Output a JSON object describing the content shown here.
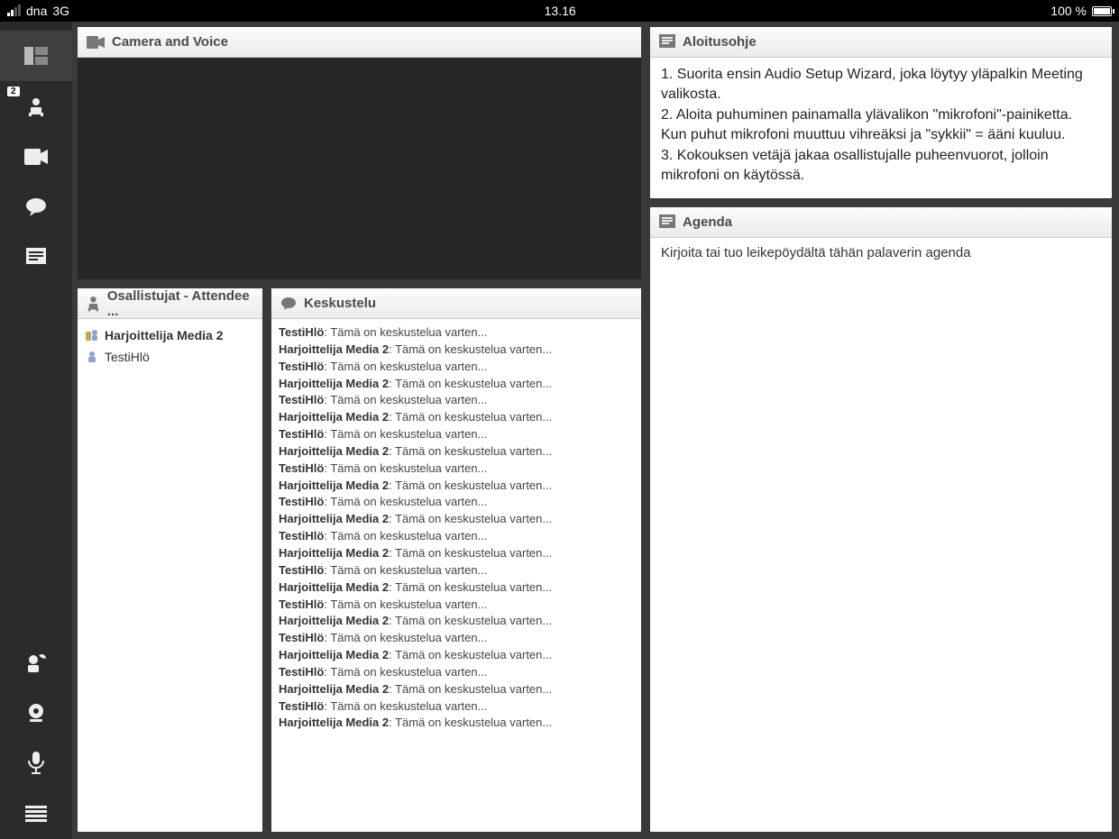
{
  "status": {
    "carrier": "dna",
    "network": "3G",
    "time": "13.16",
    "battery": "100 %"
  },
  "sidebar": {
    "badge": "2"
  },
  "panels": {
    "camera": {
      "title": "Camera and Voice"
    },
    "attendees": {
      "title": "Osallistujat - Attendee ...",
      "list": [
        {
          "name": "Harjoittelija Media 2",
          "bold": true,
          "host": true
        },
        {
          "name": "TestiHlö",
          "bold": false,
          "host": false
        }
      ]
    },
    "chat": {
      "title": "Keskustelu",
      "messages": [
        {
          "user": "TestiHlö",
          "text": "Tämä on keskustelua varten..."
        },
        {
          "user": "Harjoittelija Media 2",
          "text": "Tämä on keskustelua varten..."
        },
        {
          "user": "TestiHlö",
          "text": "Tämä on keskustelua varten..."
        },
        {
          "user": "Harjoittelija Media 2",
          "text": "Tämä on keskustelua varten..."
        },
        {
          "user": "TestiHlö",
          "text": "Tämä on keskustelua varten..."
        },
        {
          "user": "Harjoittelija Media 2",
          "text": "Tämä on keskustelua varten..."
        },
        {
          "user": "TestiHlö",
          "text": "Tämä on keskustelua varten..."
        },
        {
          "user": "Harjoittelija Media 2",
          "text": "Tämä on keskustelua varten..."
        },
        {
          "user": "TestiHlö",
          "text": "Tämä on keskustelua varten..."
        },
        {
          "user": "Harjoittelija Media 2",
          "text": "Tämä on keskustelua varten..."
        },
        {
          "user": "TestiHlö",
          "text": "Tämä on keskustelua varten..."
        },
        {
          "user": "Harjoittelija Media 2",
          "text": "Tämä on keskustelua varten..."
        },
        {
          "user": "TestiHlö",
          "text": "Tämä on keskustelua varten..."
        },
        {
          "user": "Harjoittelija Media 2",
          "text": "Tämä on keskustelua varten..."
        },
        {
          "user": "TestiHlö",
          "text": "Tämä on keskustelua varten..."
        },
        {
          "user": "Harjoittelija Media 2",
          "text": "Tämä on keskustelua varten..."
        },
        {
          "user": "TestiHlö",
          "text": "Tämä on keskustelua varten..."
        },
        {
          "user": "Harjoittelija Media 2",
          "text": "Tämä on keskustelua varten..."
        },
        {
          "user": "TestiHlö",
          "text": "Tämä on keskustelua varten..."
        },
        {
          "user": "Harjoittelija Media 2",
          "text": "Tämä on keskustelua varten..."
        },
        {
          "user": "TestiHlö",
          "text": "Tämä on keskustelua varten..."
        },
        {
          "user": "Harjoittelija Media 2",
          "text": "Tämä on keskustelua varten..."
        },
        {
          "user": "TestiHlö",
          "text": "Tämä on keskustelua varten..."
        },
        {
          "user": "Harjoittelija Media 2",
          "text": "Tämä on keskustelua varten..."
        }
      ]
    },
    "aloitus": {
      "title": "Aloitusohje",
      "lines": [
        "1. Suorita ensin Audio Setup Wizard, joka löytyy yläpalkin Meeting valikosta.",
        "2. Aloita puhuminen painamalla ylävalikon \"mikrofoni\"-painiketta. Kun puhut mikrofoni muuttuu vihreäksi ja  \"sykkii\" = ääni kuuluu.",
        "3. Kokouksen vetäjä jakaa osallistujalle puheenvuorot, jolloin mikrofoni on käytössä."
      ]
    },
    "agenda": {
      "title": "Agenda",
      "body": "Kirjoita tai tuo leikepöydältä tähän palaverin agenda"
    }
  }
}
